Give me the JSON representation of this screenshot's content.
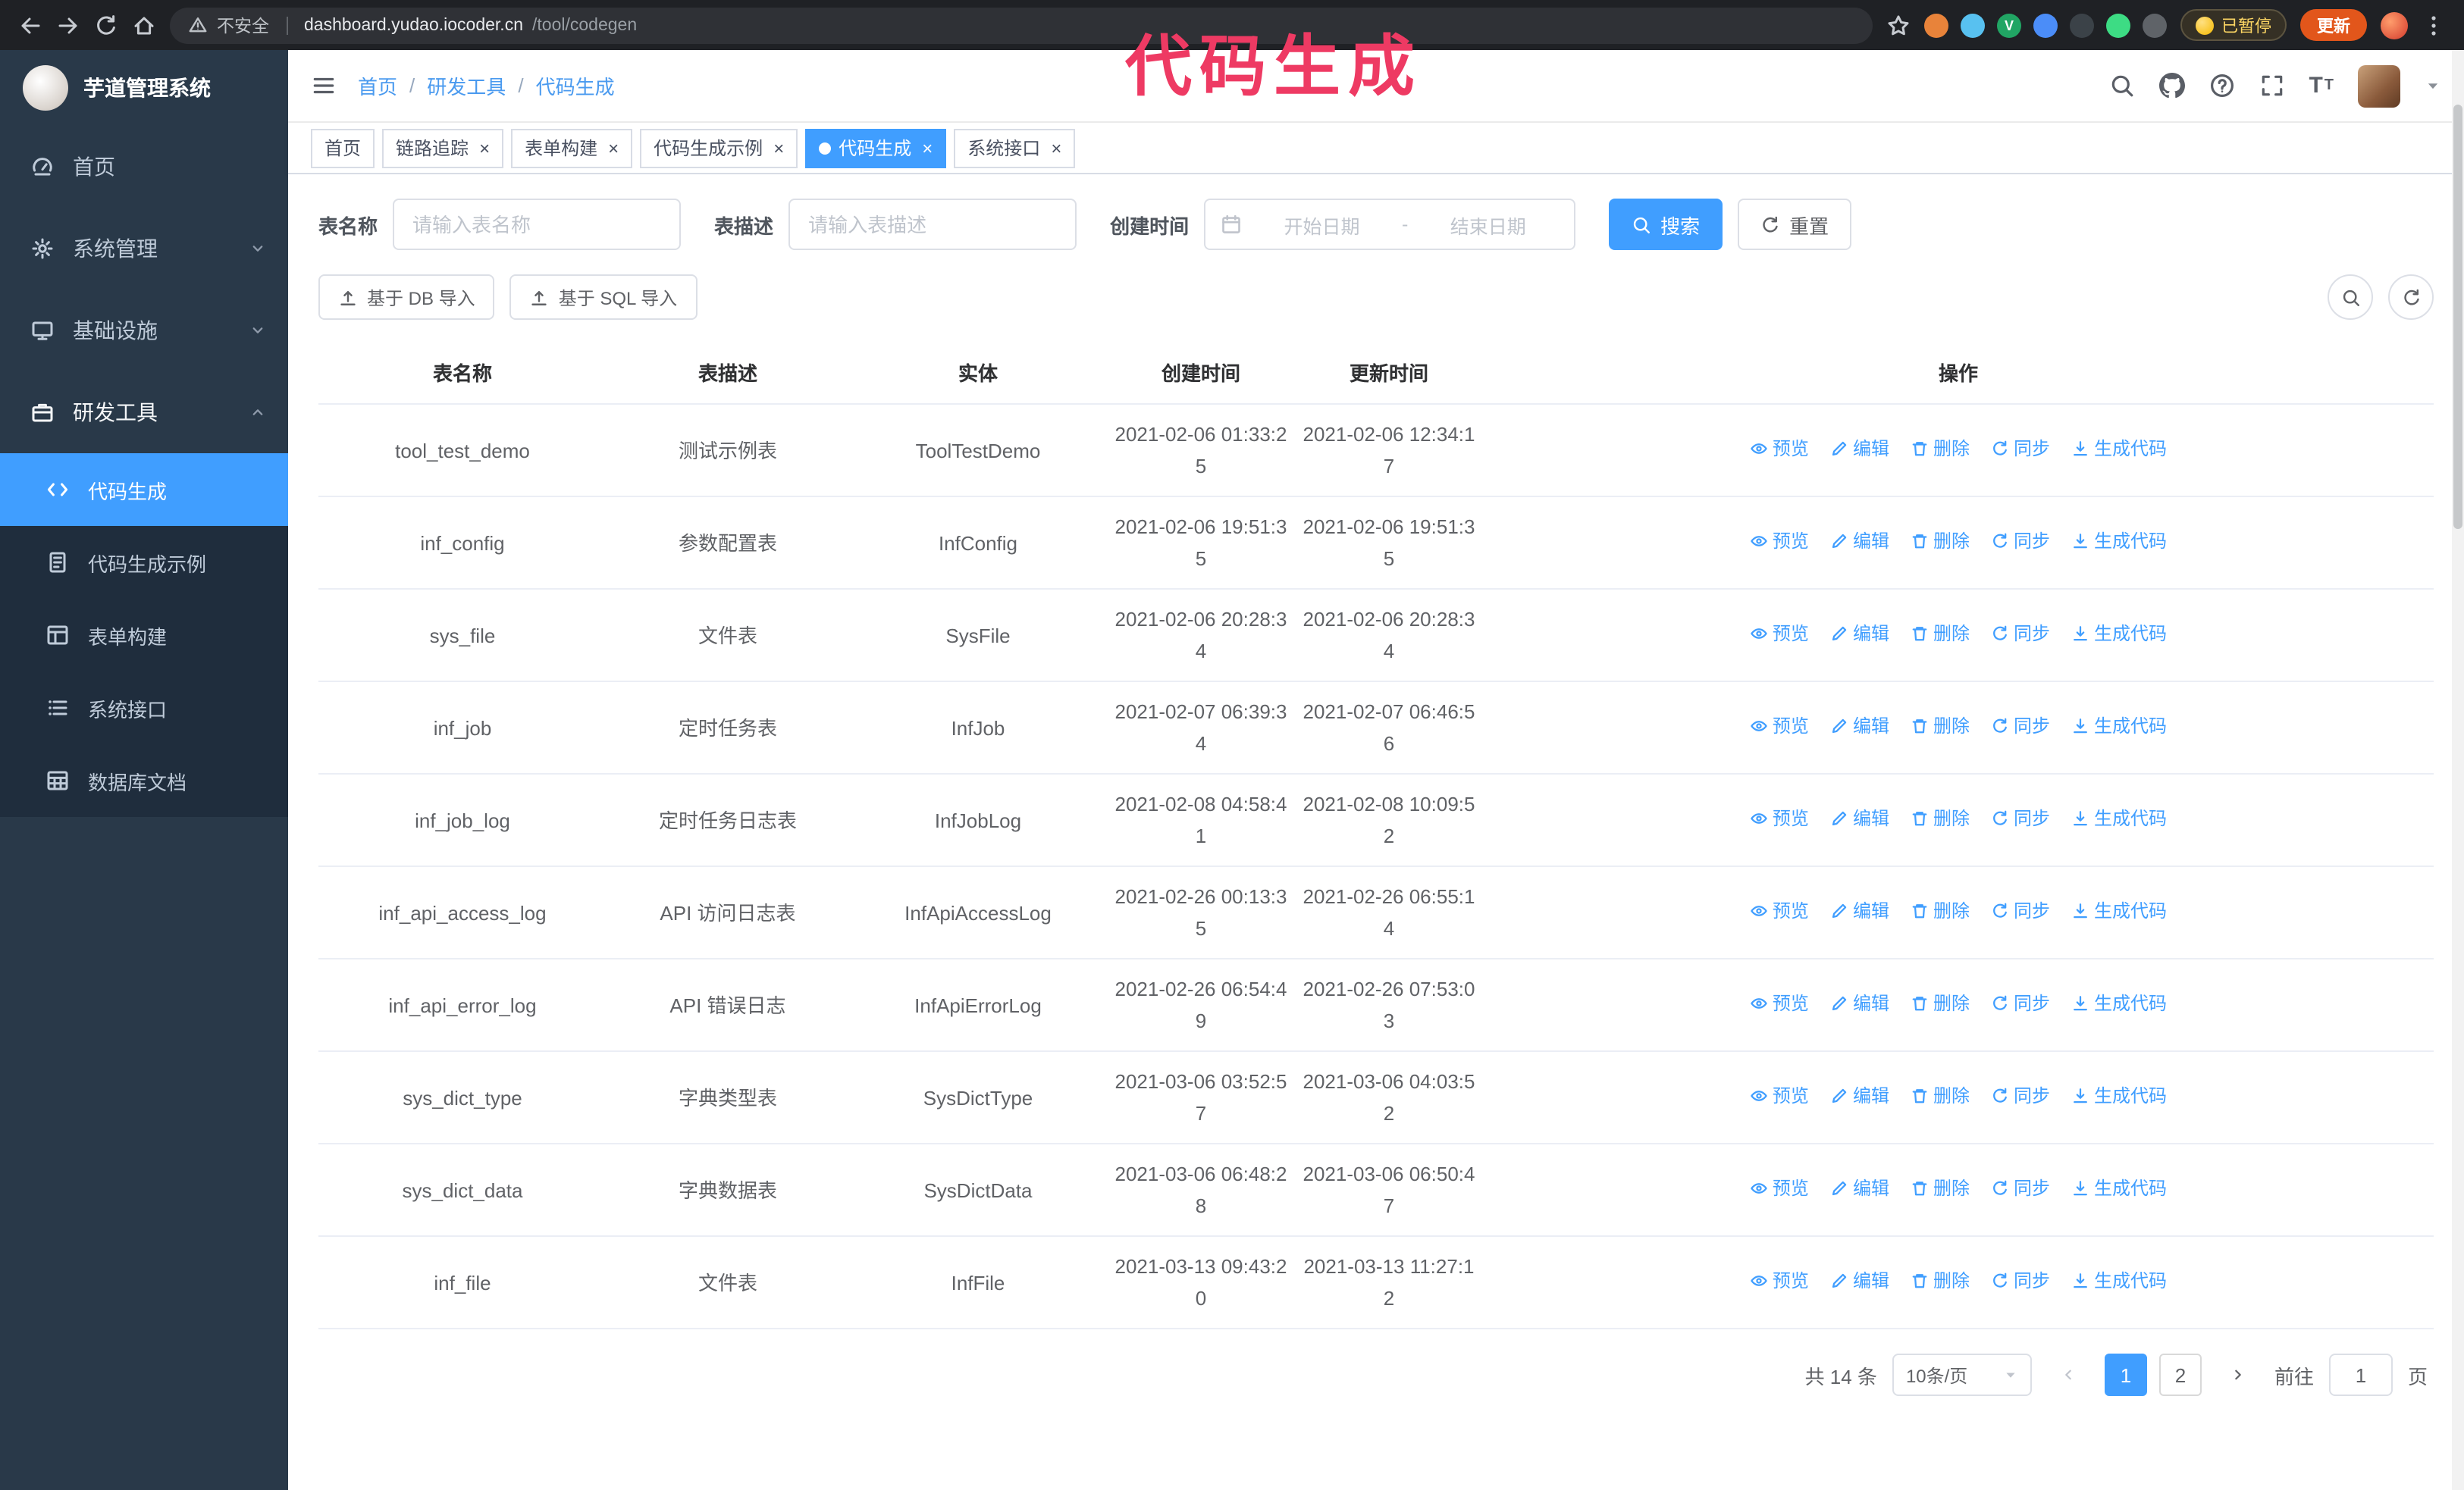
{
  "browser": {
    "security_label": "不安全",
    "url_host": "dashboard.yudao.iocoder.cn",
    "url_path": "/tool/codegen",
    "paused_badge": "已暂停",
    "update_button": "更新",
    "extensions": [
      {
        "name": "fox-extension-icon",
        "color": "#e8833a",
        "glyph": ""
      },
      {
        "name": "drop-extension-icon",
        "color": "#58c1f0",
        "glyph": ""
      },
      {
        "name": "v-extension-icon",
        "color": "#21a564",
        "glyph": "V"
      },
      {
        "name": "people-extension-icon",
        "color": "#4b8df8",
        "glyph": ""
      },
      {
        "name": "pin-extension-icon",
        "color": "#3b4248",
        "glyph": ""
      },
      {
        "name": "leaf-extension-icon",
        "color": "#3ddc84",
        "glyph": ""
      },
      {
        "name": "puzzle-extension-icon",
        "color": "#5f6368",
        "glyph": ""
      }
    ]
  },
  "annotation": {
    "text": "代码生成",
    "color": "#ee3a63"
  },
  "colors": {
    "accent": "#409eff",
    "sidebar_bg": "#293949",
    "submenu_bg": "#1f2d3d"
  },
  "sidebar": {
    "logo_title": "芋道管理系统",
    "items": [
      {
        "key": "home",
        "label": "首页",
        "icon": "gauge",
        "chevron": "",
        "open": false
      },
      {
        "key": "system",
        "label": "系统管理",
        "icon": "gear",
        "chevron": "down",
        "open": false
      },
      {
        "key": "infra",
        "label": "基础设施",
        "icon": "monitor",
        "chevron": "down",
        "open": false
      },
      {
        "key": "devtools",
        "label": "研发工具",
        "icon": "case",
        "chevron": "up",
        "open": true
      }
    ],
    "sub_items": [
      {
        "key": "codegen",
        "label": "代码生成",
        "icon": "code",
        "active": true
      },
      {
        "key": "codegen-example",
        "label": "代码生成示例",
        "icon": "doc",
        "active": false
      },
      {
        "key": "form-build",
        "label": "表单构建",
        "icon": "form",
        "active": false
      },
      {
        "key": "system-api",
        "label": "系统接口",
        "icon": "list",
        "active": false
      },
      {
        "key": "db-doc",
        "label": "数据库文档",
        "icon": "grid",
        "active": false
      }
    ]
  },
  "header": {
    "breadcrumb": {
      "items": [
        "首页",
        "研发工具",
        "代码生成"
      ],
      "separator": "/"
    }
  },
  "tabs": [
    {
      "key": "home",
      "label": "首页",
      "closable": false,
      "active": false
    },
    {
      "key": "tracing",
      "label": "链路追踪",
      "closable": true,
      "active": false
    },
    {
      "key": "form-build",
      "label": "表单构建",
      "closable": true,
      "active": false
    },
    {
      "key": "codegen-example",
      "label": "代码生成示例",
      "closable": true,
      "active": false
    },
    {
      "key": "codegen",
      "label": "代码生成",
      "closable": true,
      "active": true
    },
    {
      "key": "system-api",
      "label": "系统接口",
      "closable": true,
      "active": false
    }
  ],
  "filters": {
    "table_name_label": "表名称",
    "table_name_placeholder": "请输入表名称",
    "table_desc_label": "表描述",
    "table_desc_placeholder": "请输入表描述",
    "create_time_label": "创建时间",
    "date_start_placeholder": "开始日期",
    "date_separator": "-",
    "date_end_placeholder": "结束日期",
    "search_label": "搜索",
    "reset_label": "重置"
  },
  "toolbar": {
    "import_db_label": "基于 DB 导入",
    "import_sql_label": "基于 SQL 导入"
  },
  "table": {
    "columns": [
      "表名称",
      "表描述",
      "实体",
      "创建时间",
      "更新时间",
      "操作"
    ],
    "actions": [
      {
        "key": "preview",
        "label": "预览",
        "icon": "eye"
      },
      {
        "key": "edit",
        "label": "编辑",
        "icon": "edit"
      },
      {
        "key": "delete",
        "label": "删除",
        "icon": "trash"
      },
      {
        "key": "sync",
        "label": "同步",
        "icon": "refresh"
      },
      {
        "key": "generate",
        "label": "生成代码",
        "icon": "download"
      }
    ],
    "rows": [
      {
        "name": "tool_test_demo",
        "desc": "测试示例表",
        "entity": "ToolTestDemo",
        "created": "2021-02-06 01:33:25",
        "updated": "2021-02-06 12:34:17"
      },
      {
        "name": "inf_config",
        "desc": "参数配置表",
        "entity": "InfConfig",
        "created": "2021-02-06 19:51:35",
        "updated": "2021-02-06 19:51:35"
      },
      {
        "name": "sys_file",
        "desc": "文件表",
        "entity": "SysFile",
        "created": "2021-02-06 20:28:34",
        "updated": "2021-02-06 20:28:34"
      },
      {
        "name": "inf_job",
        "desc": "定时任务表",
        "entity": "InfJob",
        "created": "2021-02-07 06:39:34",
        "updated": "2021-02-07 06:46:56"
      },
      {
        "name": "inf_job_log",
        "desc": "定时任务日志表",
        "entity": "InfJobLog",
        "created": "2021-02-08 04:58:41",
        "updated": "2021-02-08 10:09:52"
      },
      {
        "name": "inf_api_access_log",
        "desc": "API 访问日志表",
        "entity": "InfApiAccessLog",
        "created": "2021-02-26 00:13:35",
        "updated": "2021-02-26 06:55:14"
      },
      {
        "name": "inf_api_error_log",
        "desc": "API 错误日志",
        "entity": "InfApiErrorLog",
        "created": "2021-02-26 06:54:49",
        "updated": "2021-02-26 07:53:03"
      },
      {
        "name": "sys_dict_type",
        "desc": "字典类型表",
        "entity": "SysDictType",
        "created": "2021-03-06 03:52:57",
        "updated": "2021-03-06 04:03:52"
      },
      {
        "name": "sys_dict_data",
        "desc": "字典数据表",
        "entity": "SysDictData",
        "created": "2021-03-06 06:48:28",
        "updated": "2021-03-06 06:50:47"
      },
      {
        "name": "inf_file",
        "desc": "文件表",
        "entity": "InfFile",
        "created": "2021-03-13 09:43:20",
        "updated": "2021-03-13 11:27:12"
      }
    ]
  },
  "pagination": {
    "total": "共 14 条",
    "page_size": "10条/页",
    "pages": [
      {
        "label": "1",
        "active": true
      },
      {
        "label": "2",
        "active": false
      }
    ],
    "goto_label": "前往",
    "goto_value": "1",
    "goto_suffix": "页"
  }
}
